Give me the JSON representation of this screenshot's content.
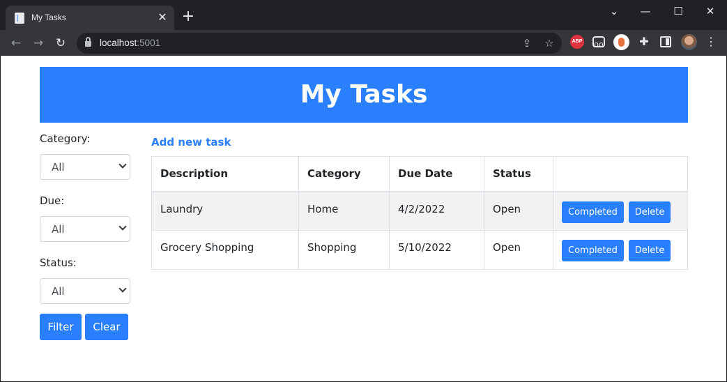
{
  "browser": {
    "tab_title": "My Tasks",
    "tab_close": "✕",
    "new_tab": "+",
    "url_host": "localhost",
    "url_port": ":5001"
  },
  "page": {
    "title": "My Tasks",
    "add_link": "Add new task"
  },
  "filters": {
    "category_label": "Category:",
    "category_value": "All",
    "due_label": "Due:",
    "due_value": "All",
    "status_label": "Status:",
    "status_value": "All",
    "filter_button": "Filter",
    "clear_button": "Clear"
  },
  "table": {
    "headers": [
      "Description",
      "Category",
      "Due Date",
      "Status",
      ""
    ],
    "rows": [
      {
        "description": "Laundry",
        "category": "Home",
        "due": "4/2/2022",
        "status": "Open",
        "completed": "Completed",
        "delete": "Delete"
      },
      {
        "description": "Grocery Shopping",
        "category": "Shopping",
        "due": "5/10/2022",
        "status": "Open",
        "completed": "Completed",
        "delete": "Delete"
      }
    ]
  },
  "colors": {
    "accent": "#2a7fff",
    "chrome_dark": "#202124",
    "chrome_toolbar": "#35363a"
  }
}
